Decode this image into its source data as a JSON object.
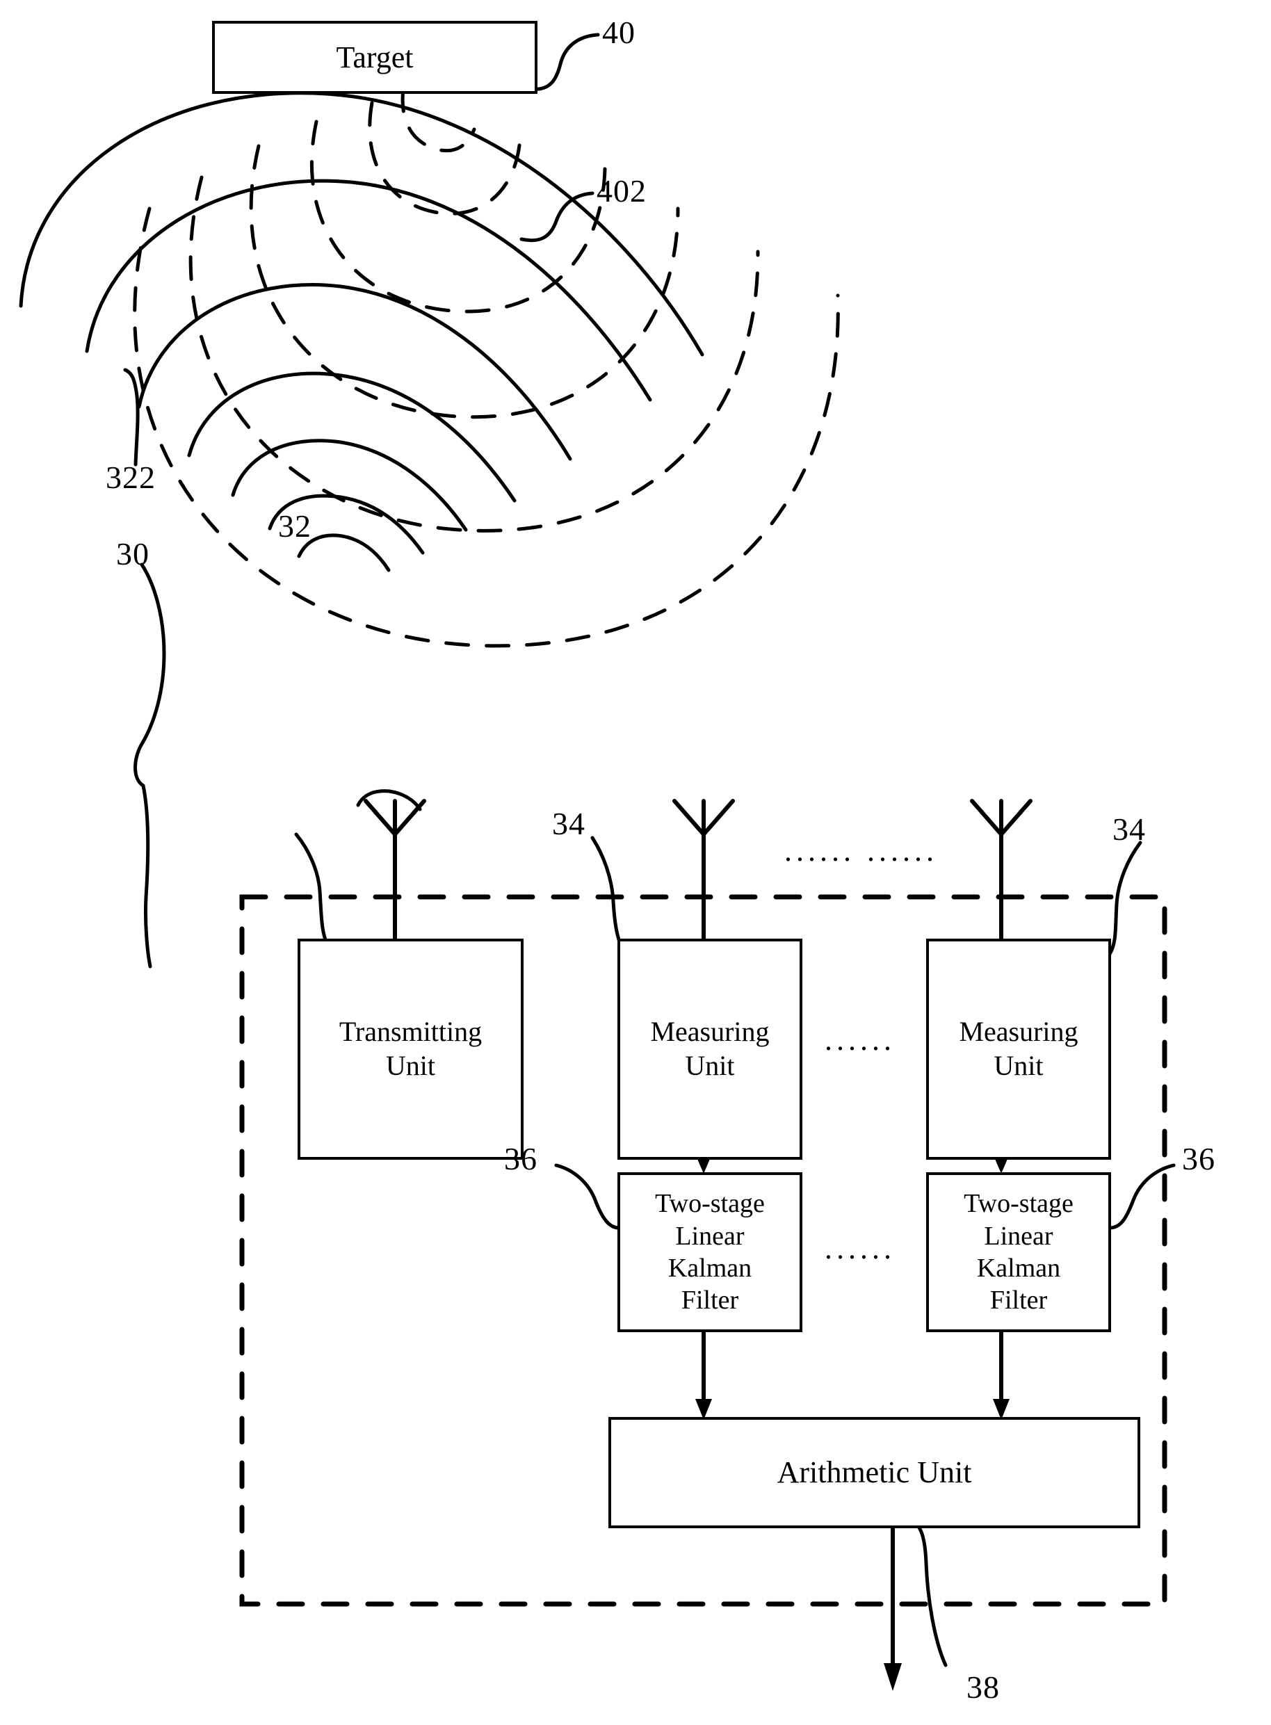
{
  "figure": {
    "kind": "patent-block-diagram",
    "title": "Radar target tracking system block diagram",
    "line_color": "#000000",
    "background": "#ffffff"
  },
  "blocks": {
    "target": {
      "label": "Target",
      "ref": "40"
    },
    "transmitting_unit": {
      "label": "Transmitting\nUnit",
      "line1": "Transmitting",
      "line2": "Unit",
      "ref": "32"
    },
    "measuring_unit_1": {
      "label": "Measuring\nUnit",
      "line1": "Measuring",
      "line2": "Unit",
      "ref": "34"
    },
    "measuring_unit_n": {
      "label": "Measuring\nUnit",
      "line1": "Measuring",
      "line2": "Unit",
      "ref": "34"
    },
    "kalman_filter_1": {
      "line1": "Two-stage",
      "line2": "Linear",
      "line3": "Kalman",
      "line4": "Filter",
      "ref": "36"
    },
    "kalman_filter_n": {
      "line1": "Two-stage",
      "line2": "Linear",
      "line3": "Kalman",
      "line4": "Filter",
      "ref": "36"
    },
    "arithmetic_unit": {
      "label": "Arithmetic Unit"
    }
  },
  "reference_numerals": {
    "target": "40",
    "reflected_wave": "402",
    "transmitted_wave": "322",
    "system_enclosure": "30",
    "transmitting_unit": "32",
    "measuring_unit_left": "34",
    "measuring_unit_right": "34",
    "kalman_filter_left": "36",
    "kalman_filter_right": "36",
    "output": "38"
  },
  "ellipses": {
    "antenna_row": "...... ......",
    "unit_row": "......",
    "filter_row": "......"
  },
  "icons": {
    "antenna_transmit": "antenna-icon",
    "antenna_receive_1": "antenna-icon",
    "antenna_receive_n": "antenna-icon",
    "transmitted_wavefront": "solid-arc-wave",
    "reflected_wavefront": "dashed-arc-wave",
    "signal_arrow": "down-arrow"
  }
}
